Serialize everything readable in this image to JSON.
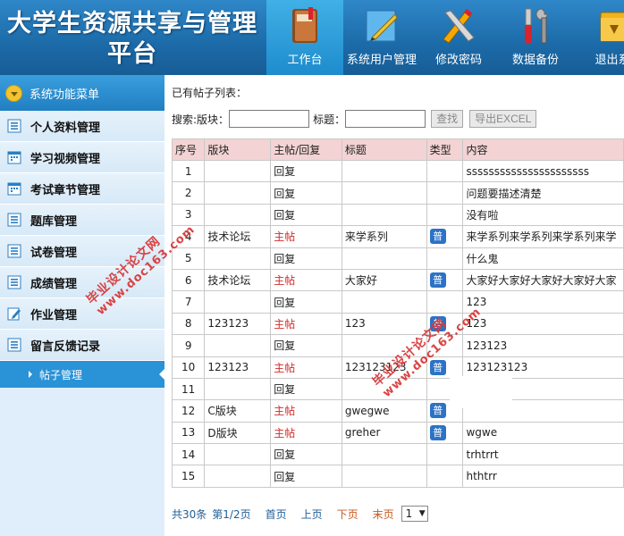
{
  "header": {
    "title": "大学生资源共享与管理平台",
    "nav": [
      {
        "label": "工作台",
        "icon": "book-icon",
        "active": true
      },
      {
        "label": "系统用户管理",
        "icon": "ruler-pencil-icon",
        "active": false
      },
      {
        "label": "修改密码",
        "icon": "pencil-ruler-icon",
        "active": false
      },
      {
        "label": "数据备份",
        "icon": "tools-icon",
        "active": false
      },
      {
        "label": "退出系",
        "icon": "folder-exit-icon",
        "active": false
      }
    ]
  },
  "sidebar": {
    "heading": "系统功能菜单",
    "items": [
      {
        "label": "个人资料管理",
        "icon": "list-icon"
      },
      {
        "label": "学习视频管理",
        "icon": "calendar-icon"
      },
      {
        "label": "考试章节管理",
        "icon": "calendar-icon"
      },
      {
        "label": "题库管理",
        "icon": "list-icon"
      },
      {
        "label": "试卷管理",
        "icon": "list-icon"
      },
      {
        "label": "成绩管理",
        "icon": "list-icon"
      },
      {
        "label": "作业管理",
        "icon": "edit-icon"
      },
      {
        "label": "留言反馈记录",
        "icon": "list-icon"
      }
    ],
    "active_sub": "帖子管理"
  },
  "main": {
    "caption": "已有帖子列表：",
    "search": {
      "label": "搜索:",
      "board_label": "版块：",
      "board_value": "",
      "title_label": "标题：",
      "title_value": "",
      "find_button": "查找",
      "export_button": "导出EXCEL"
    },
    "table": {
      "columns": [
        "序号",
        "版块",
        "主帖/回复",
        "标题",
        "类型",
        "内容"
      ],
      "rows": [
        {
          "no": "1",
          "board": "",
          "kind": "回复",
          "title": "",
          "type": "",
          "content": "ssssssssssssssssssssss"
        },
        {
          "no": "2",
          "board": "",
          "kind": "回复",
          "title": "",
          "type": "",
          "content": "问题要描述清楚"
        },
        {
          "no": "3",
          "board": "",
          "kind": "回复",
          "title": "",
          "type": "",
          "content": "没有啦"
        },
        {
          "no": "4",
          "board": "技术论坛",
          "kind": "主帖",
          "title": "来学系列",
          "type": "普",
          "content": "来学系列来学系列来学系列来学"
        },
        {
          "no": "5",
          "board": "",
          "kind": "回复",
          "title": "",
          "type": "",
          "content": "什么鬼"
        },
        {
          "no": "6",
          "board": "技术论坛",
          "kind": "主帖",
          "title": "大家好",
          "type": "普",
          "content": "大家好大家好大家好大家好大家"
        },
        {
          "no": "7",
          "board": "",
          "kind": "回复",
          "title": "",
          "type": "",
          "content": "123"
        },
        {
          "no": "8",
          "board": "123123",
          "kind": "主帖",
          "title": "123",
          "type": "普",
          "content": "123"
        },
        {
          "no": "9",
          "board": "",
          "kind": "回复",
          "title": "",
          "type": "",
          "content": "123123"
        },
        {
          "no": "10",
          "board": "123123",
          "kind": "主帖",
          "title": "123123123",
          "type": "普",
          "content": "123123123"
        },
        {
          "no": "11",
          "board": "",
          "kind": "回复",
          "title": "",
          "type": "",
          "content": ""
        },
        {
          "no": "12",
          "board": "C版块",
          "kind": "主帖",
          "title": "gwegwe",
          "type": "普",
          "content": ""
        },
        {
          "no": "13",
          "board": "D版块",
          "kind": "主帖",
          "title": "greher",
          "type": "普",
          "content": "wgwe"
        },
        {
          "no": "14",
          "board": "",
          "kind": "回复",
          "title": "",
          "type": "",
          "content": "trhtrrt"
        },
        {
          "no": "15",
          "board": "",
          "kind": "回复",
          "title": "",
          "type": "",
          "content": "hthtrr"
        }
      ]
    },
    "pager": {
      "total": "共30条",
      "page_info": "第1/2页",
      "first": "首页",
      "prev": "上页",
      "next": "下页",
      "last": "末页",
      "select_value": "1"
    }
  },
  "watermarks": [
    {
      "line1": "毕业设计论文网",
      "line2": "www.doc163.com"
    },
    {
      "line1": "毕业设计论文网",
      "line2": "www.doc163.com"
    }
  ],
  "colors": {
    "header_blue": "#1c6aa8",
    "active_blue": "#2a92d6",
    "table_head": "#f3d3d3",
    "main_post_red": "#d32b2b",
    "badge_blue": "#2c72c6"
  }
}
